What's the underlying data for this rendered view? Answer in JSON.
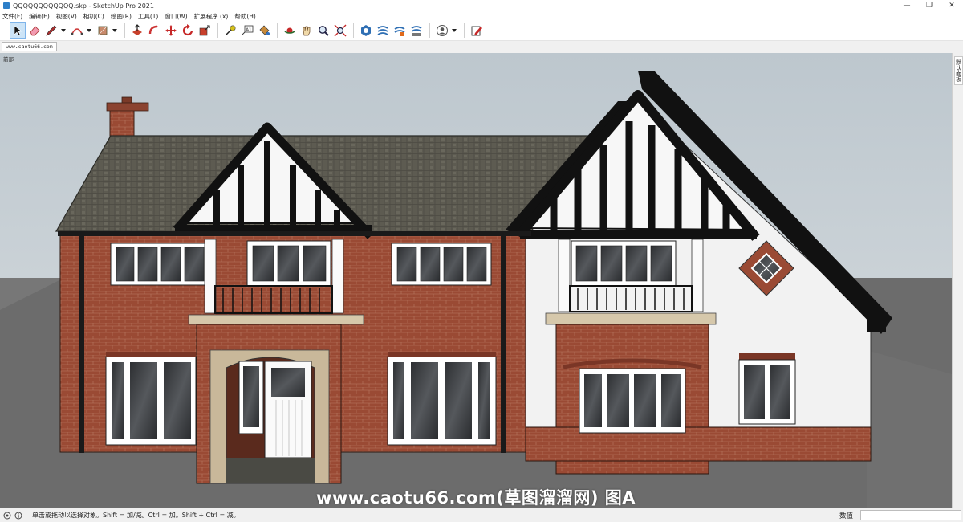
{
  "window": {
    "title": "QQQQQQQQQQQQ.skp - SketchUp Pro 2021",
    "minimize": "—",
    "restore": "❐",
    "close": "✕"
  },
  "menu": [
    "文件(F)",
    "编辑(E)",
    "视图(V)",
    "相机(C)",
    "绘图(R)",
    "工具(T)",
    "窗口(W)",
    "扩展程序 (x)",
    "帮助(H)"
  ],
  "scene_tab": "www.caotu66.com",
  "viewport": {
    "view_label": "前部",
    "watermark": "www.caotu66.com(草图溜溜网) 图A"
  },
  "tray": {
    "tab_label": "默认面板"
  },
  "status": {
    "hint": "单击或拖动以选择对象。Shift = 加/减。Ctrl = 加。Shift + Ctrl = 减。",
    "measure_label": "数值",
    "measure_value": ""
  },
  "colors": {
    "sky": "#c9d2d8",
    "ground": "#6e6e6e",
    "brick": "#9a4a34",
    "roof": "#5c5a50",
    "timber": "#111111",
    "render": "#f2f2f2",
    "stone": "#c9b89a"
  }
}
